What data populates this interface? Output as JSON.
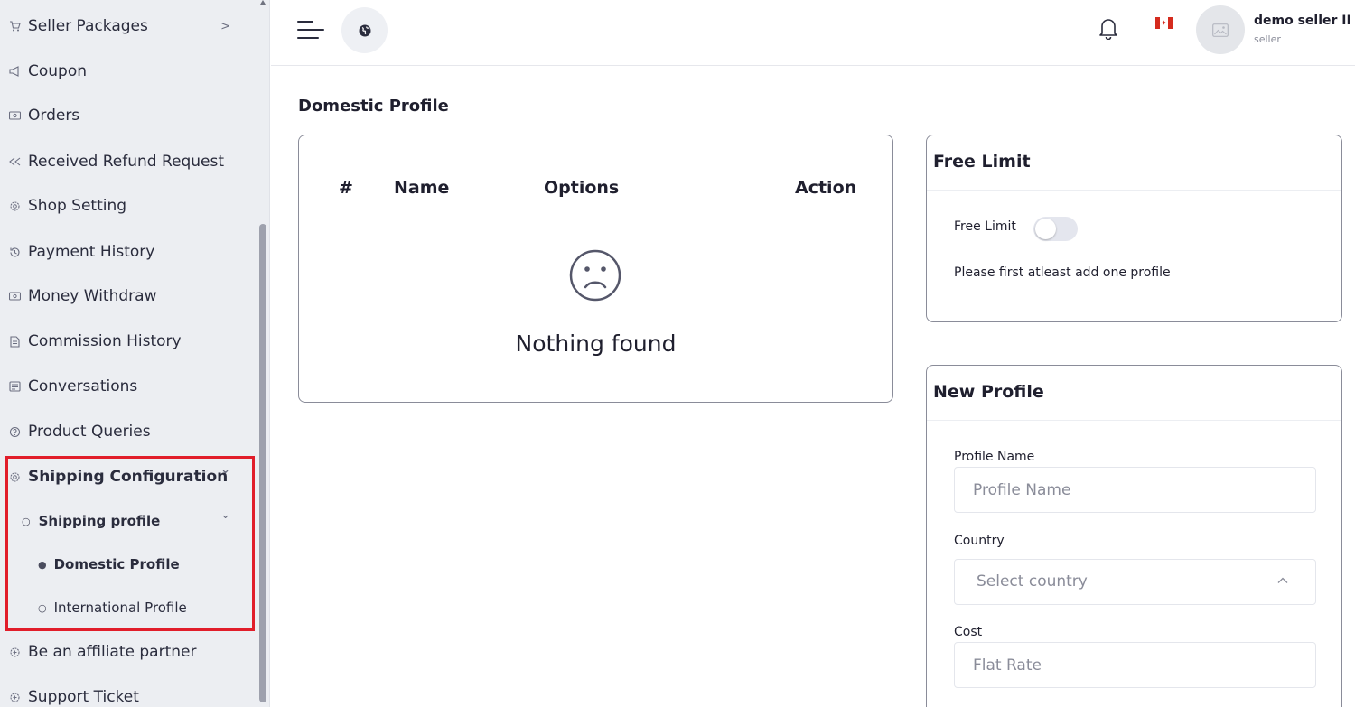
{
  "sidebar": {
    "items": [
      {
        "label": "Seller Packages",
        "icon": "cart-icon",
        "chevron": ">"
      },
      {
        "label": "Coupon",
        "icon": "megaphone-icon"
      },
      {
        "label": "Orders",
        "icon": "money-icon"
      },
      {
        "label": "Received Refund Request",
        "icon": "rewind-icon"
      },
      {
        "label": "Shop Setting",
        "icon": "gear-icon"
      },
      {
        "label": "Payment History",
        "icon": "history-icon"
      },
      {
        "label": "Money Withdraw",
        "icon": "money-icon"
      },
      {
        "label": "Commission History",
        "icon": "document-icon"
      },
      {
        "label": "Conversations",
        "icon": "chat-icon"
      },
      {
        "label": "Product Queries",
        "icon": "question-icon"
      }
    ],
    "shipping": {
      "label": "Shipping Configuration",
      "icon": "cog-icon",
      "chevron": "⌄",
      "profile": {
        "label": "Shipping profile",
        "chevron": "⌄"
      },
      "sub_items": [
        {
          "label": "Domestic Profile",
          "active": true
        },
        {
          "label": "International Profile",
          "active": false
        }
      ]
    },
    "after_items": [
      {
        "label": "Be an affiliate partner",
        "icon": "affiliate-icon"
      },
      {
        "label": "Support Ticket",
        "icon": "affiliate-icon"
      }
    ]
  },
  "topbar": {
    "user_name": "demo seller II",
    "user_role": "seller",
    "flag": "canada-flag-icon"
  },
  "main": {
    "page_title": "Domestic Profile",
    "table": {
      "headers": [
        "#",
        "Name",
        "Options",
        "Action"
      ],
      "empty_text": "Nothing found"
    },
    "free_limit": {
      "title": "Free Limit",
      "toggle_label": "Free Limit",
      "toggle_on": false,
      "note": "Please first atleast add one profile"
    },
    "new_profile": {
      "title": "New Profile",
      "profile_name_label": "Profile Name",
      "profile_name_placeholder": "Profile Name",
      "country_label": "Country",
      "country_value": "Select country",
      "cost_label": "Cost",
      "cost_placeholder": "Flat Rate"
    }
  },
  "colors": {
    "highlight": "#e11d2a",
    "sidebar_bg": "#eceef2",
    "text": "#1f1f2e"
  }
}
